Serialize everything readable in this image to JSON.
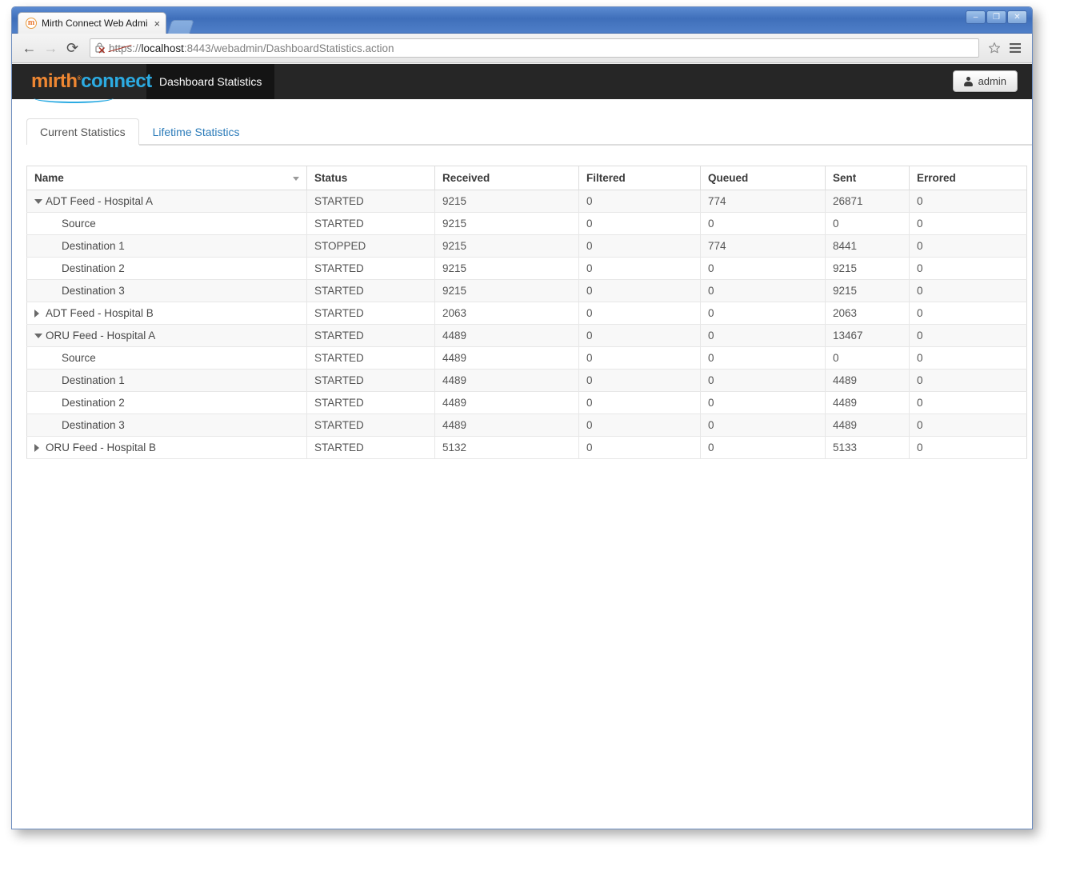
{
  "browser": {
    "tab_title": "Mirth Connect Web Admi",
    "favicon_letter": "m",
    "tab_close": "×",
    "back_icon": "←",
    "forward_icon": "→",
    "reload_icon": "⟳",
    "url_scheme": "https",
    "url_sep": "://",
    "url_host": "localhost",
    "url_rest": ":8443/webadmin/DashboardStatistics.action",
    "bookmark_icon": "☆",
    "menu_icon": "☰",
    "minimize": "–",
    "restore": "❐",
    "close": "✕"
  },
  "app": {
    "logo_mirth": "mirth",
    "logo_connect": "connect",
    "logo_tm": "®",
    "nav_item": "Dashboard Statistics",
    "user_label": "admin"
  },
  "tabs": [
    {
      "label": "Current Statistics",
      "active": true
    },
    {
      "label": "Lifetime Statistics",
      "active": false
    }
  ],
  "table": {
    "columns": [
      "Name",
      "Status",
      "Received",
      "Filtered",
      "Queued",
      "Sent",
      "Errored"
    ],
    "sorted_column": "Name",
    "sort_direction": "desc",
    "rows": [
      {
        "name": "ADT Feed - Hospital A",
        "level": 0,
        "toggle": "open",
        "status": "STARTED",
        "received": "9215",
        "filtered": "0",
        "queued": "774",
        "sent": "26871",
        "errored": "0"
      },
      {
        "name": "Source",
        "level": 1,
        "toggle": "none",
        "status": "STARTED",
        "received": "9215",
        "filtered": "0",
        "queued": "0",
        "sent": "0",
        "errored": "0"
      },
      {
        "name": "Destination 1",
        "level": 1,
        "toggle": "none",
        "status": "STOPPED",
        "received": "9215",
        "filtered": "0",
        "queued": "774",
        "sent": "8441",
        "errored": "0"
      },
      {
        "name": "Destination 2",
        "level": 1,
        "toggle": "none",
        "status": "STARTED",
        "received": "9215",
        "filtered": "0",
        "queued": "0",
        "sent": "9215",
        "errored": "0"
      },
      {
        "name": "Destination 3",
        "level": 1,
        "toggle": "none",
        "status": "STARTED",
        "received": "9215",
        "filtered": "0",
        "queued": "0",
        "sent": "9215",
        "errored": "0"
      },
      {
        "name": "ADT Feed - Hospital B",
        "level": 0,
        "toggle": "closed",
        "status": "STARTED",
        "received": "2063",
        "filtered": "0",
        "queued": "0",
        "sent": "2063",
        "errored": "0"
      },
      {
        "name": "ORU Feed - Hospital A",
        "level": 0,
        "toggle": "open",
        "status": "STARTED",
        "received": "4489",
        "filtered": "0",
        "queued": "0",
        "sent": "13467",
        "errored": "0"
      },
      {
        "name": "Source",
        "level": 1,
        "toggle": "none",
        "status": "STARTED",
        "received": "4489",
        "filtered": "0",
        "queued": "0",
        "sent": "0",
        "errored": "0"
      },
      {
        "name": "Destination 1",
        "level": 1,
        "toggle": "none",
        "status": "STARTED",
        "received": "4489",
        "filtered": "0",
        "queued": "0",
        "sent": "4489",
        "errored": "0"
      },
      {
        "name": "Destination 2",
        "level": 1,
        "toggle": "none",
        "status": "STARTED",
        "received": "4489",
        "filtered": "0",
        "queued": "0",
        "sent": "4489",
        "errored": "0"
      },
      {
        "name": "Destination 3",
        "level": 1,
        "toggle": "none",
        "status": "STARTED",
        "received": "4489",
        "filtered": "0",
        "queued": "0",
        "sent": "4489",
        "errored": "0"
      },
      {
        "name": "ORU Feed - Hospital B",
        "level": 0,
        "toggle": "closed",
        "status": "STARTED",
        "received": "5132",
        "filtered": "0",
        "queued": "0",
        "sent": "5133",
        "errored": "0"
      }
    ]
  },
  "colors": {
    "brand_orange": "#ef8732",
    "brand_blue": "#2cabe2",
    "appbar": "#262626",
    "link": "#2b7bb9"
  }
}
